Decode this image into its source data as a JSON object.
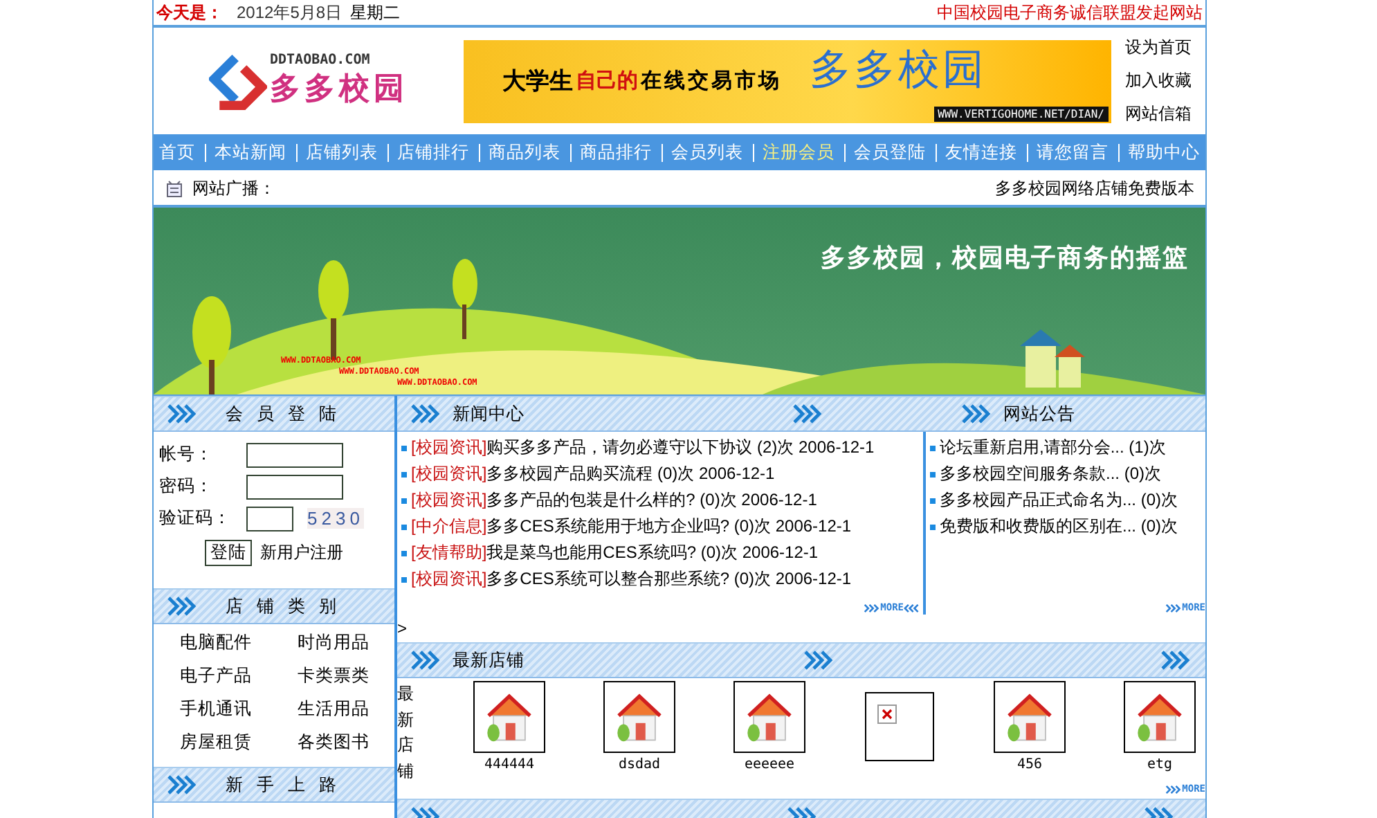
{
  "top_bar": {
    "today_label": "今天是：",
    "date": "2012年5月8日",
    "weekday": "星期二",
    "alliance_link": "中国校园电子商务诚信联盟发起网站"
  },
  "logo": {
    "domain": "DDTAOBAO.COM",
    "name": "多多校园"
  },
  "banner": {
    "lead": "大学生",
    "highlight": "自己的",
    "rest": "在线交易市场",
    "brand": "多多校园",
    "url": "WWW.VERTIGOHOME.NET/DIAN/"
  },
  "header_links": [
    "设为首页",
    "加入收藏",
    "网站信箱"
  ],
  "nav": [
    {
      "label": "首页",
      "selected": false
    },
    {
      "label": "本站新闻",
      "selected": false
    },
    {
      "label": "店铺列表",
      "selected": false
    },
    {
      "label": "店铺排行",
      "selected": false
    },
    {
      "label": "商品列表",
      "selected": false
    },
    {
      "label": "商品排行",
      "selected": false
    },
    {
      "label": "会员列表",
      "selected": false
    },
    {
      "label": "注册会员",
      "selected": true
    },
    {
      "label": "会员登陆",
      "selected": false
    },
    {
      "label": "友情连接",
      "selected": false
    },
    {
      "label": "请您留言",
      "selected": false
    },
    {
      "label": "帮助中心",
      "selected": false
    }
  ],
  "broadcast": {
    "label": "网站广播：",
    "message": "多多校园网络店铺免费版本"
  },
  "hero": {
    "slogan": "多多校园，校园电子商务的摇篮",
    "watermarks": [
      "WWW.DDTAOBAO.COM",
      "WWW.DDTAOBAO.COM",
      "WWW.DDTAOBAO.COM"
    ]
  },
  "login": {
    "title": "会 员 登 陆",
    "account_label": "帐号：",
    "password_label": "密码：",
    "captcha_label": "验证码：",
    "captcha": "5230",
    "submit": "登陆",
    "register": "新用户注册"
  },
  "shop_categories": {
    "title": "店 铺 类 别",
    "items": [
      "电脑配件",
      "时尚用品",
      "电子产品",
      "卡类票类",
      "手机通讯",
      "生活用品",
      "房屋租赁",
      "各类图书"
    ]
  },
  "beginner": {
    "title": "新 手 上 路"
  },
  "news": {
    "title": "新闻中心",
    "more": "MORE",
    "items": [
      {
        "tag": "[校园资讯]",
        "title": "购买多多产品，请勿必遵守以下协议",
        "count": "(2)次",
        "date": "2006-12-1"
      },
      {
        "tag": "[校园资讯]",
        "title": "多多校园产品购买流程",
        "count": "(0)次",
        "date": "2006-12-1"
      },
      {
        "tag": "[校园资讯]",
        "title": "多多产品的包装是什么样的?",
        "count": "(0)次",
        "date": "2006-12-1"
      },
      {
        "tag": "[中介信息]",
        "title": "多多CES系统能用于地方企业吗?",
        "count": "(0)次",
        "date": "2006-12-1"
      },
      {
        "tag": "[友情帮助]",
        "title": "我是菜鸟也能用CES系统吗?",
        "count": "(0)次",
        "date": "2006-12-1"
      },
      {
        "tag": "[校园资讯]",
        "title": "多多CES系统可以整合那些系统?",
        "count": "(0)次",
        "date": "2006-12-1"
      }
    ]
  },
  "notices": {
    "title": "网站公告",
    "more": "MORE",
    "items": [
      {
        "title": "论坛重新启用,请部分会...",
        "count": "(1)次"
      },
      {
        "title": "多多校园空间服务条款...",
        "count": "(0)次"
      },
      {
        "title": "多多校园产品正式命名为...",
        "count": "(0)次"
      },
      {
        "title": "免费版和收费版的区别在...",
        "count": "(0)次"
      }
    ]
  },
  "stray_mark": ">",
  "latest_shops": {
    "title": "最新店铺",
    "side_label": "最新店铺",
    "more": "MORE",
    "shops": [
      {
        "name": "444444",
        "kind": "logo"
      },
      {
        "name": "dsdad",
        "kind": "logo"
      },
      {
        "name": "eeeeee",
        "kind": "logo"
      },
      {
        "kind": "broken"
      },
      {
        "name": "456",
        "kind": "logo"
      },
      {
        "name": "etg",
        "kind": "logo"
      }
    ]
  }
}
